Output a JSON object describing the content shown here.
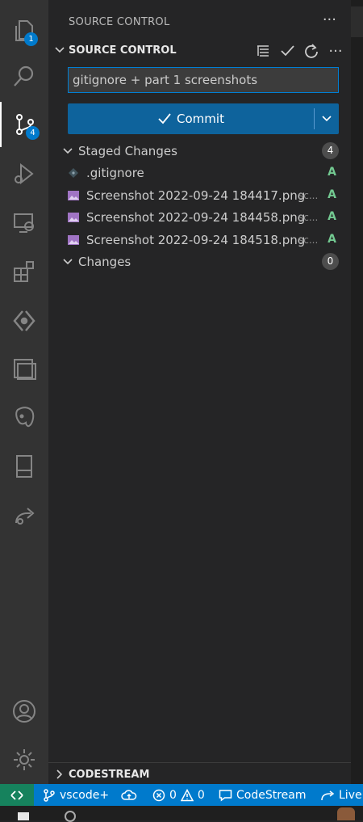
{
  "activity_bar": {
    "items": [
      {
        "name": "explorer",
        "badge": "1"
      },
      {
        "name": "search",
        "badge": null
      },
      {
        "name": "source-control",
        "badge": "4"
      },
      {
        "name": "run-and-debug",
        "badge": null
      },
      {
        "name": "remote-explorer",
        "badge": null
      },
      {
        "name": "extensions",
        "badge": null
      },
      {
        "name": "codestream",
        "badge": null
      },
      {
        "name": "panels",
        "badge": null
      },
      {
        "name": "postgres",
        "badge": null
      },
      {
        "name": "sidebar-panel",
        "badge": null
      },
      {
        "name": "live-share",
        "badge": null
      }
    ],
    "bottom": [
      {
        "name": "accounts"
      },
      {
        "name": "manage"
      }
    ]
  },
  "sidebar": {
    "title": "SOURCE CONTROL",
    "more": "···",
    "section_title": "SOURCE CONTROL",
    "commit_message": "gitignore + part 1 screenshots",
    "commit_label": "Commit",
    "staged": {
      "label": "Staged Changes",
      "count": "4",
      "files": [
        {
          "name": ".gitignore",
          "dir": "",
          "status": "A",
          "type": "git"
        },
        {
          "name": "Screenshot 2022-09-24 184417.png",
          "dir": "sc...",
          "status": "A",
          "type": "image"
        },
        {
          "name": "Screenshot 2022-09-24 184458.png",
          "dir": "sc...",
          "status": "A",
          "type": "image"
        },
        {
          "name": "Screenshot 2022-09-24 184518.png",
          "dir": "sc...",
          "status": "A",
          "type": "image"
        }
      ]
    },
    "changes": {
      "label": "Changes",
      "count": "0"
    },
    "codestream_title": "CODESTREAM"
  },
  "statusbar": {
    "branch": "vscode+",
    "errors": "0",
    "warnings": "0",
    "codestream": "CodeStream",
    "live": "Live"
  },
  "colors": {
    "accent": "#007acc",
    "commit_button": "#0e639c",
    "added_status": "#73c991",
    "remote": "#16825d"
  }
}
